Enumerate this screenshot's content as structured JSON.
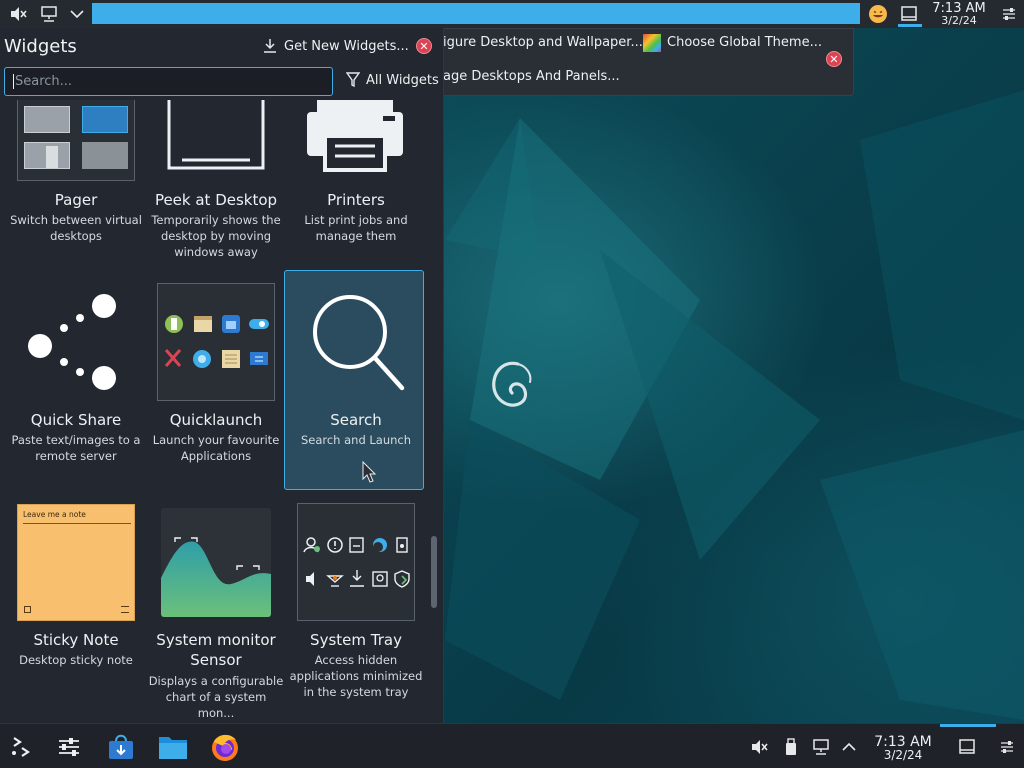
{
  "top_panel": {
    "clock_time": "7:13 AM",
    "clock_date": "3/2/24"
  },
  "toolbox": {
    "configure_desktop": "igure Desktop and Wallpaper...",
    "choose_theme": "Choose Global Theme...",
    "manage_panels": "age Desktops And Panels..."
  },
  "widgets_panel": {
    "title": "Widgets",
    "get_new": "Get New Widgets...",
    "search_placeholder": "Search...",
    "filter_label": "All Widgets",
    "widgets": [
      {
        "name": "Pager",
        "desc": "Switch between virtual desktops"
      },
      {
        "name": "Peek at Desktop",
        "desc": "Temporarily shows the desktop by moving windows away"
      },
      {
        "name": "Printers",
        "desc": "List print jobs and manage them"
      },
      {
        "name": "Quick Share",
        "desc": "Paste text/images to a remote server"
      },
      {
        "name": "Quicklaunch",
        "desc": "Launch your favourite Applications"
      },
      {
        "name": "Search",
        "desc": "Search and Launch"
      },
      {
        "name": "Sticky Note",
        "desc": "Desktop sticky note",
        "note_text": "Leave me a note"
      },
      {
        "name": "System monitor Sensor",
        "desc": "Displays a configurable chart of a system mon..."
      },
      {
        "name": "System Tray",
        "desc": "Access hidden applications minimized in the system tray"
      }
    ]
  },
  "bottom_panel": {
    "clock_time": "7:13 AM",
    "clock_date": "3/2/24"
  },
  "colors": {
    "accent": "#3daee9",
    "panel": "#252a31",
    "close": "#da4453",
    "sticky": "#f8c06e"
  }
}
